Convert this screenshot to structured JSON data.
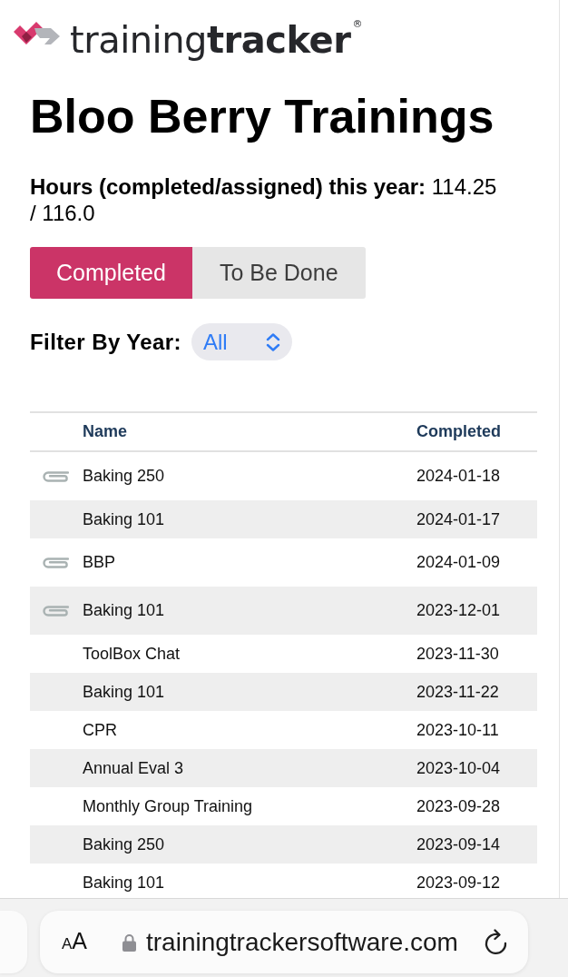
{
  "logo": {
    "wordmark": "training**tracker**$^{®}$"
  },
  "page_title": "Bloo Berry Trainings",
  "hours_summary": {
    "label": "Hours (completed/assigned) this year:",
    "value": "114.25 / 116.0"
  },
  "tabs": [
    {
      "label": "Completed",
      "selected": true
    },
    {
      "label": "To Be Done",
      "selected": false
    }
  ],
  "year_filter": {
    "label": "Filter By Year:",
    "value": "All"
  },
  "table": {
    "columns": [
      "Name",
      "Completed"
    ],
    "rows": [
      {
        "attachment": true,
        "name": "Baking 250",
        "completed": "2024-01-18"
      },
      {
        "attachment": false,
        "name": "Baking 101",
        "completed": "2024-01-17"
      },
      {
        "attachment": true,
        "name": "BBP",
        "completed": "2024-01-09"
      },
      {
        "attachment": true,
        "name": "Baking 101",
        "completed": "2023-12-01"
      },
      {
        "attachment": false,
        "name": "ToolBox Chat",
        "completed": "2023-11-30"
      },
      {
        "attachment": false,
        "name": "Baking 101",
        "completed": "2023-11-22"
      },
      {
        "attachment": false,
        "name": "CPR",
        "completed": "2023-10-11"
      },
      {
        "attachment": false,
        "name": "Annual Eval 3",
        "completed": "2023-10-04"
      },
      {
        "attachment": false,
        "name": "Monthly Group Training",
        "completed": "2023-09-28"
      },
      {
        "attachment": false,
        "name": "Baking 250",
        "completed": "2023-09-14"
      },
      {
        "attachment": false,
        "name": "Baking 101",
        "completed": "2023-09-12"
      }
    ]
  },
  "browser_bar": {
    "text_size_button": "AA",
    "url": "trainingtrackersoftware.com"
  }
}
